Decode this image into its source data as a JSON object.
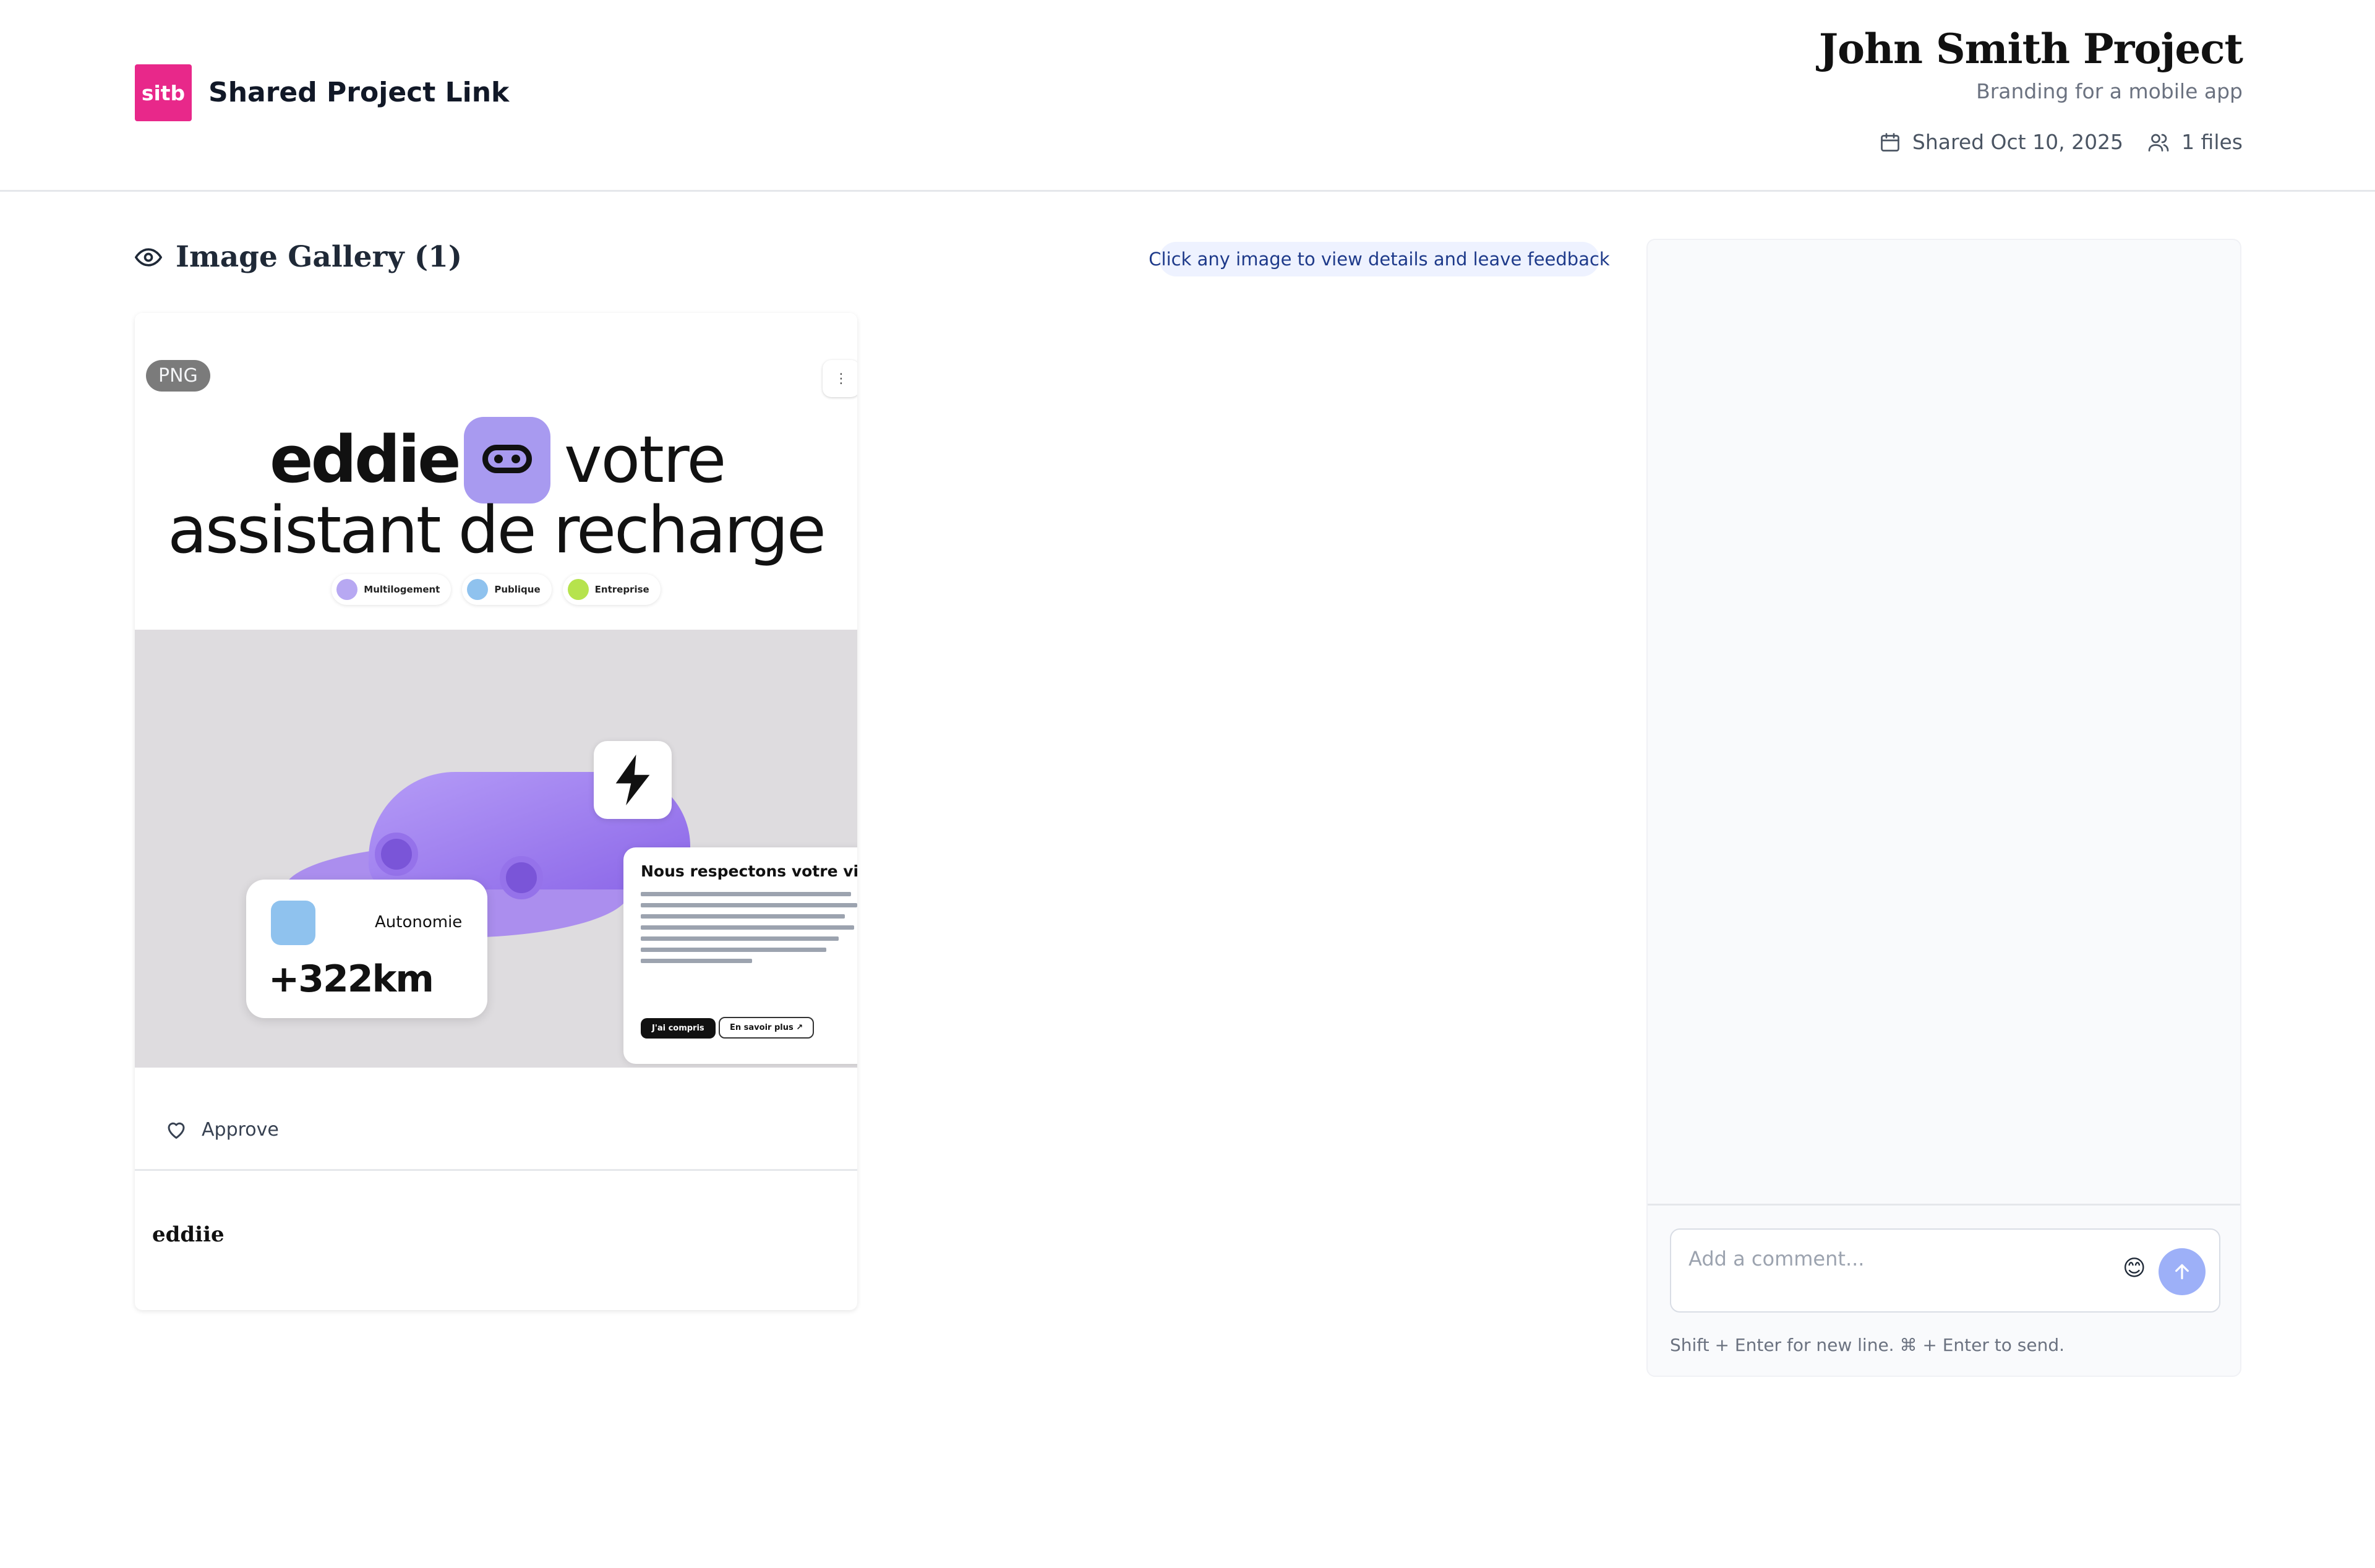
{
  "header": {
    "logo_text": "sitb",
    "brand_title": "Shared Project Link",
    "project_title": "John Smith Project",
    "project_subtitle": "Branding for a mobile app",
    "shared_date": "Shared Oct 10, 2025",
    "files_count": "1 files",
    "accent_color": "#e8288a"
  },
  "gallery": {
    "title": "Image Gallery (1)",
    "hint": "Click any image to view details and leave feedback",
    "items": [
      {
        "type_badge": "PNG",
        "menu_label": "⋮",
        "approve_label": "Approve",
        "name": "eddiie",
        "artwork": {
          "brand_word": "eddie",
          "headline_end": "votre",
          "headline_line2": "assistant de recharge",
          "chips": [
            "Multilogement",
            "Publique",
            "Entreprise"
          ],
          "autonomy_label": "Autonomie",
          "autonomy_value": "+322km",
          "cookie_title": "Nous respectons votre vie p",
          "cookie_accept": "J'ai compris",
          "cookie_more": "En savoir plus ↗"
        }
      }
    ]
  },
  "comments": {
    "placeholder": "Add a comment...",
    "emoji": "😊",
    "hint": "Shift + Enter for new line. ⌘ + Enter to send."
  },
  "icons": {
    "header_meta": [
      "calendar-icon",
      "users-icon"
    ],
    "gallery": "eye-icon",
    "approve": "heart-icon",
    "send": "arrow-up-icon"
  }
}
